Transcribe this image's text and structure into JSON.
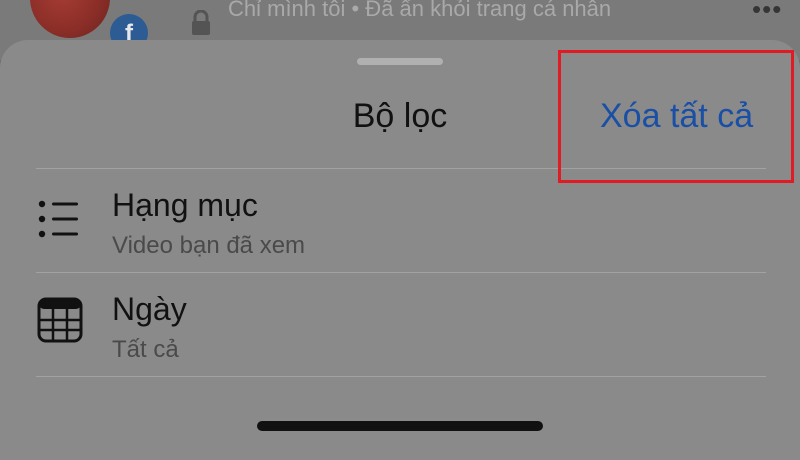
{
  "background_post": {
    "privacy_text": "Chỉ mình tôi • Đã ẩn khỏi trang cá nhân",
    "badge_letter": "f",
    "more_glyph": "•••"
  },
  "filter_sheet": {
    "title": "Bộ lọc",
    "clear_all_label": "Xóa tất cả",
    "items": [
      {
        "label": "Hạng mục",
        "value": "Video bạn đã xem",
        "icon": "list-icon"
      },
      {
        "label": "Ngày",
        "value": "Tất cả",
        "icon": "calendar-icon"
      }
    ]
  },
  "colors": {
    "accent_link": "#1a4fa6",
    "highlight": "#e01b24",
    "sheet_background": "#8a8a8a"
  }
}
